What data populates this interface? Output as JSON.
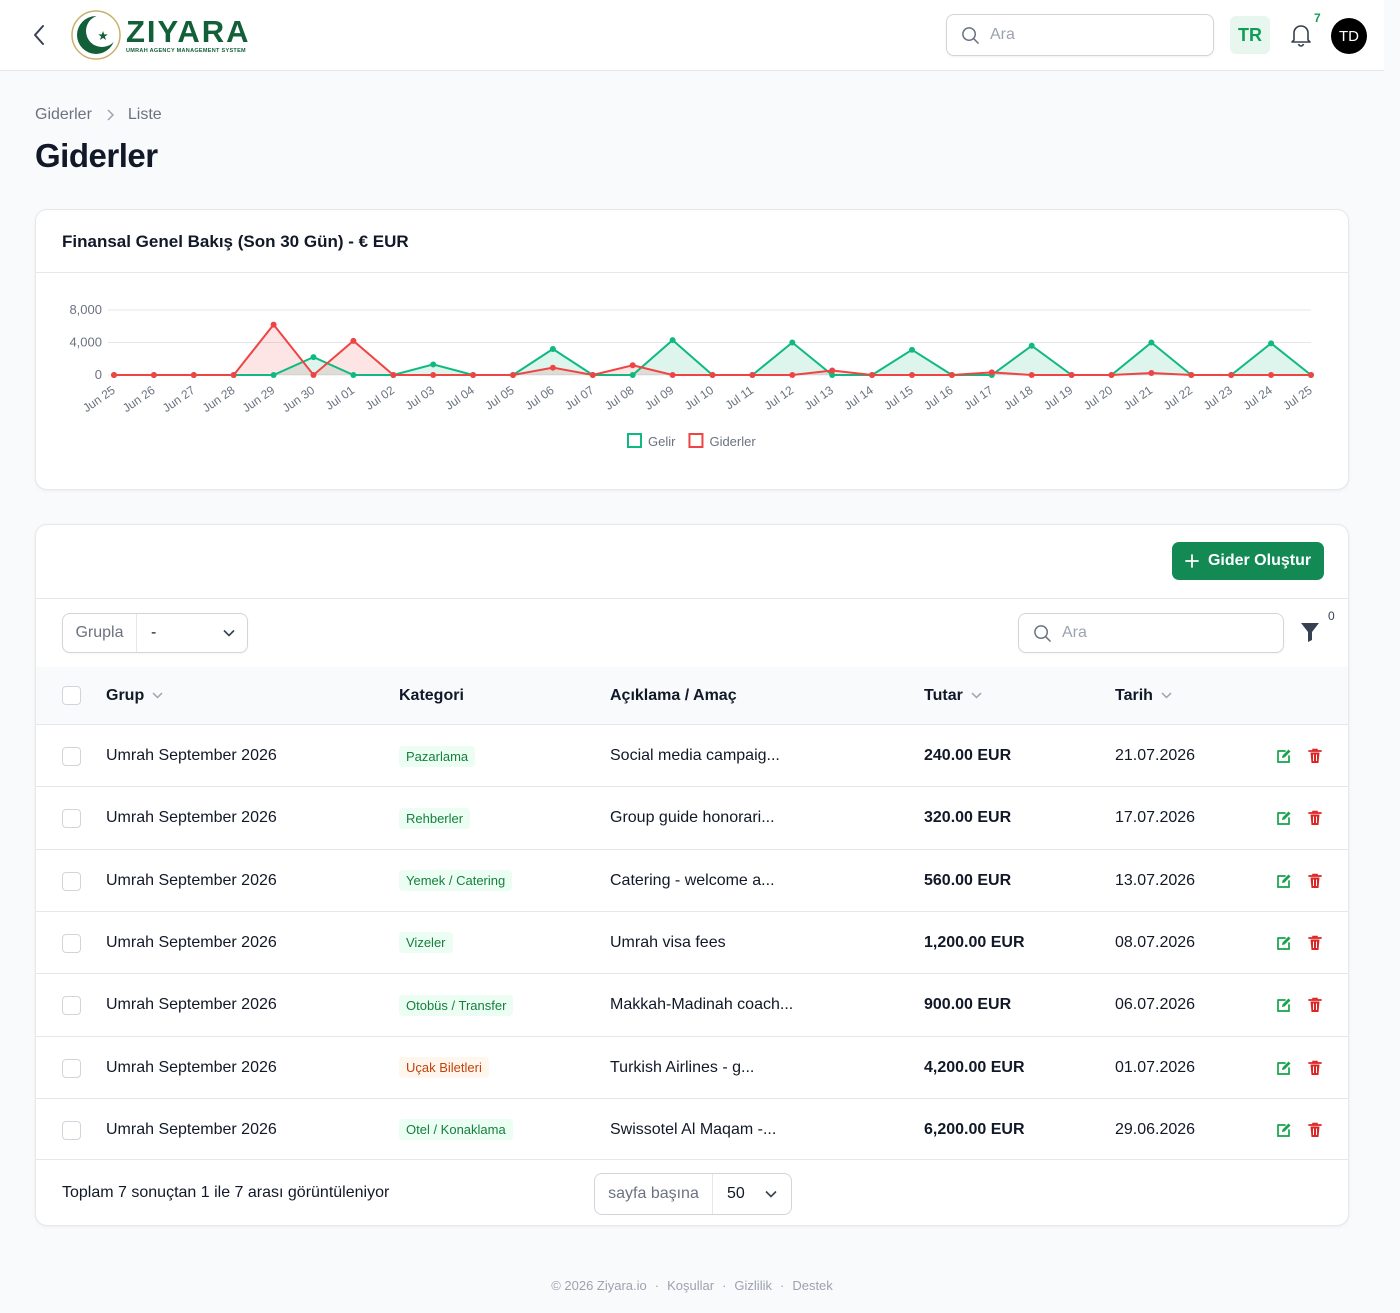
{
  "topbar": {
    "logo_name": "ZIYARA",
    "logo_tagline": "UMRAH AGENCY MANAGEMENT SYSTEM",
    "search_placeholder": "Ara",
    "language": "TR",
    "notification_count": "7",
    "avatar_initials": "TD"
  },
  "breadcrumb": [
    "Giderler",
    "Liste"
  ],
  "page_title": "Giderler",
  "chart_card": {
    "title": "Finansal Genel Bakış (Son 30 Gün) - € EUR"
  },
  "chart_data": {
    "type": "line",
    "x": [
      "Jun 25",
      "Jun 26",
      "Jun 27",
      "Jun 28",
      "Jun 29",
      "Jun 30",
      "Jul 01",
      "Jul 02",
      "Jul 03",
      "Jul 04",
      "Jul 05",
      "Jul 06",
      "Jul 07",
      "Jul 08",
      "Jul 09",
      "Jul 10",
      "Jul 11",
      "Jul 12",
      "Jul 13",
      "Jul 14",
      "Jul 15",
      "Jul 16",
      "Jul 17",
      "Jul 18",
      "Jul 19",
      "Jul 20",
      "Jul 21",
      "Jul 22",
      "Jul 23",
      "Jul 24",
      "Jul 25"
    ],
    "series": [
      {
        "name": "Gelir",
        "color": "#10b981",
        "values": [
          0,
          0,
          0,
          0,
          0,
          2200,
          0,
          0,
          1300,
          0,
          0,
          3200,
          0,
          0,
          4300,
          0,
          0,
          4000,
          0,
          0,
          3100,
          0,
          0,
          3600,
          0,
          0,
          4000,
          0,
          0,
          3900,
          0
        ]
      },
      {
        "name": "Giderler",
        "color": "#ef4444",
        "values": [
          0,
          0,
          0,
          0,
          6200,
          0,
          4200,
          0,
          0,
          0,
          0,
          900,
          0,
          1200,
          0,
          0,
          0,
          0,
          560,
          0,
          0,
          0,
          320,
          0,
          0,
          0,
          240,
          0,
          0,
          0,
          0
        ]
      }
    ],
    "yticks": [
      0,
      4000,
      8000
    ],
    "ylim": [
      0,
      8000
    ],
    "grid": true,
    "legend": "bottom-center"
  },
  "table_card": {
    "create_button": "Gider Oluştur",
    "group_label": "Grupla",
    "group_value": "-",
    "search_placeholder": "Ara",
    "filter_count": "0",
    "columns": {
      "group": "Grup",
      "category": "Kategori",
      "description": "Açıklama / Amaç",
      "amount": "Tutar",
      "date": "Tarih"
    },
    "rows": [
      {
        "group": "Umrah September 2026",
        "category": "Pazarlama",
        "badge_color": "green",
        "description": "Social media campaig...",
        "amount": "240.00 EUR",
        "date": "21.07.2026"
      },
      {
        "group": "Umrah September 2026",
        "category": "Rehberler",
        "badge_color": "green",
        "description": "Group guide honorari...",
        "amount": "320.00 EUR",
        "date": "17.07.2026"
      },
      {
        "group": "Umrah September 2026",
        "category": "Yemek / Catering",
        "badge_color": "green",
        "description": "Catering - welcome a...",
        "amount": "560.00 EUR",
        "date": "13.07.2026"
      },
      {
        "group": "Umrah September 2026",
        "category": "Vizeler",
        "badge_color": "green",
        "description": "Umrah visa fees",
        "amount": "1,200.00 EUR",
        "date": "08.07.2026"
      },
      {
        "group": "Umrah September 2026",
        "category": "Otobüs / Transfer",
        "badge_color": "green",
        "description": "Makkah-Madinah coach...",
        "amount": "900.00 EUR",
        "date": "06.07.2026"
      },
      {
        "group": "Umrah September 2026",
        "category": "Uçak Biletleri",
        "badge_color": "orange",
        "description": "Turkish Airlines - g...",
        "amount": "4,200.00 EUR",
        "date": "01.07.2026"
      },
      {
        "group": "Umrah September 2026",
        "category": "Otel / Konaklama",
        "badge_color": "green",
        "description": "Swissotel Al Maqam -...",
        "amount": "6,200.00 EUR",
        "date": "29.06.2026"
      }
    ],
    "result_text": "Toplam 7 sonuçtan 1 ile 7 arası görüntüleniyor",
    "per_page_label": "sayfa başına",
    "per_page_value": "50"
  },
  "footer": {
    "copyright": "© 2026 Ziyara.io",
    "links": [
      "Koşullar",
      "Gizlilik",
      "Destek"
    ]
  },
  "colors": {
    "brand": "#135f3a",
    "accent": "#138a54",
    "income": "#10b981",
    "expense": "#ef4444",
    "delete": "#dc2626"
  }
}
